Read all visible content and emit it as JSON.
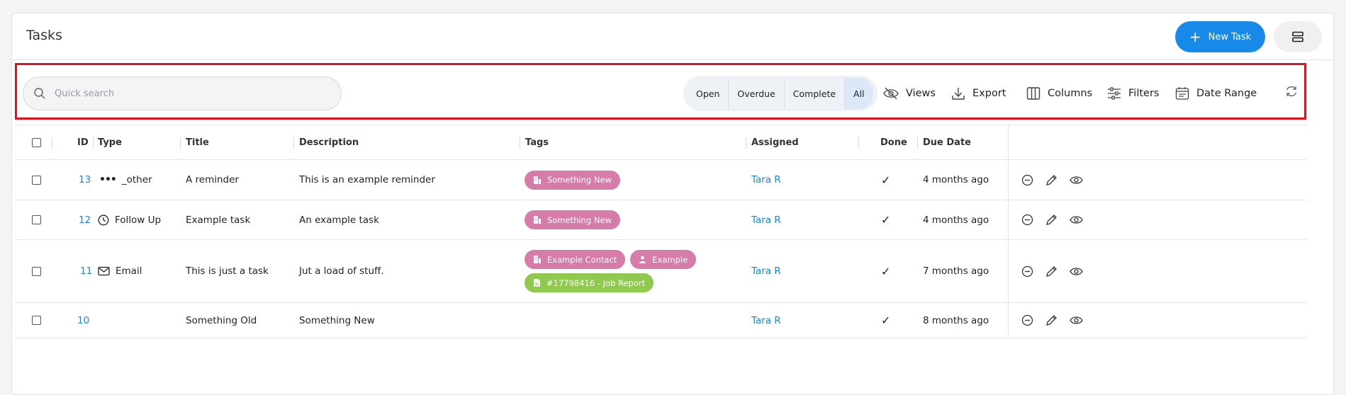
{
  "header": {
    "title": "Tasks",
    "new_task_label": "New Task"
  },
  "toolbar": {
    "search_placeholder": "Quick search",
    "segments": [
      "Open",
      "Overdue",
      "Complete",
      "All"
    ],
    "active_segment": "All",
    "views": "Views",
    "export": "Export",
    "columns": "Columns",
    "filters": "Filters",
    "date_range": "Date Range"
  },
  "table": {
    "headers": {
      "id": "ID",
      "type": "Type",
      "title": "Title",
      "description": "Description",
      "tags": "Tags",
      "assigned": "Assigned",
      "done": "Done",
      "due": "Due Date"
    },
    "rows": [
      {
        "id": "13",
        "type": "_other",
        "type_icon": "more-dots-icon",
        "title": "A reminder",
        "description": "This is an example reminder",
        "tags": [
          [
            "Something New"
          ]
        ],
        "assigned": "Tara R",
        "done": "✓",
        "due": "4 months ago"
      },
      {
        "id": "12",
        "type": "Follow Up",
        "type_icon": "clock-icon",
        "title": "Example task",
        "description": "An example task",
        "tags": [
          [
            "Something New"
          ]
        ],
        "assigned": "Tara R",
        "done": "✓",
        "due": "4 months ago"
      },
      {
        "id": "11",
        "type": "Email",
        "type_icon": "mail-icon",
        "title": "This is just a task",
        "description": "Jut a load of stuff.",
        "tags": [
          [
            "Example Contact",
            "Example"
          ],
          [
            "#17798416 - Job Report"
          ]
        ],
        "assigned": "Tara R",
        "done": "✓",
        "due": "7 months ago"
      },
      {
        "id": "10",
        "type": "",
        "type_icon": "",
        "title": "Something Old",
        "description": "Something New",
        "tags": [],
        "assigned": "Tara R",
        "done": "✓",
        "due": "8 months ago"
      }
    ]
  },
  "colors": {
    "accent": "#1789e8",
    "tag_pink": "#d67ca8",
    "tag_green": "#8fc94e",
    "highlight": "#e0141e"
  }
}
